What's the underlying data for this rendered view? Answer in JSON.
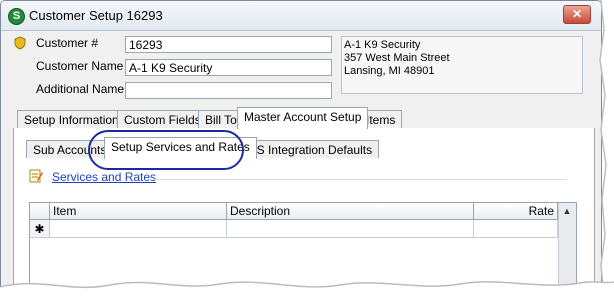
{
  "window": {
    "title": "Customer Setup 16293",
    "close_label": "✕"
  },
  "form": {
    "customer_number_label": "Customer #",
    "customer_number_value": "16293",
    "customer_name_label": "Customer Name",
    "customer_name_value": "A-1 K9 Security",
    "additional_name_label": "Additional Name",
    "additional_name_value": ""
  },
  "address": {
    "line1": "A-1 K9 Security",
    "line2": "357 West Main Street",
    "line3": "Lansing, MI  48901"
  },
  "main_tabs": [
    {
      "label": "Setup Information",
      "active": false
    },
    {
      "label": "Custom Fields",
      "active": false
    },
    {
      "label": "Bill To",
      "active": false
    },
    {
      "label": "Master Account Setup",
      "active": true
    },
    {
      "label": "Items",
      "active": false
    }
  ],
  "sub_tabs": [
    {
      "label": "Sub Accounts",
      "active": false
    },
    {
      "label": "Setup Services and Rates",
      "active": true
    },
    {
      "label": "CS Integration Defaults",
      "active": false
    }
  ],
  "section": {
    "title": "Services and Rates"
  },
  "grid": {
    "columns": [
      "Item",
      "Description",
      "Rate"
    ],
    "new_row_marker": "✱"
  },
  "colors": {
    "highlight": "#1b2aa0",
    "link": "#1f3fbf"
  }
}
